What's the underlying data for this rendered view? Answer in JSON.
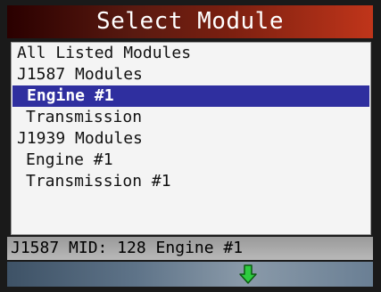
{
  "header": {
    "title": "Select Module"
  },
  "list": {
    "items": [
      {
        "label": "All Listed Modules",
        "indent": false,
        "selected": false
      },
      {
        "label": "J1587 Modules",
        "indent": false,
        "selected": false
      },
      {
        "label": "Engine #1",
        "indent": true,
        "selected": true
      },
      {
        "label": "Transmission",
        "indent": true,
        "selected": false
      },
      {
        "label": "J1939 Modules",
        "indent": false,
        "selected": false
      },
      {
        "label": "Engine #1",
        "indent": true,
        "selected": false
      },
      {
        "label": "Transmission #1",
        "indent": true,
        "selected": false
      }
    ]
  },
  "status": {
    "text": "J1587 MID: 128 Engine #1"
  },
  "footer": {
    "icon": "arrow-down-icon"
  },
  "colors": {
    "selection": "#2f2f9f",
    "header_accent": "#c0351a",
    "arrow": "#2ecc40"
  }
}
